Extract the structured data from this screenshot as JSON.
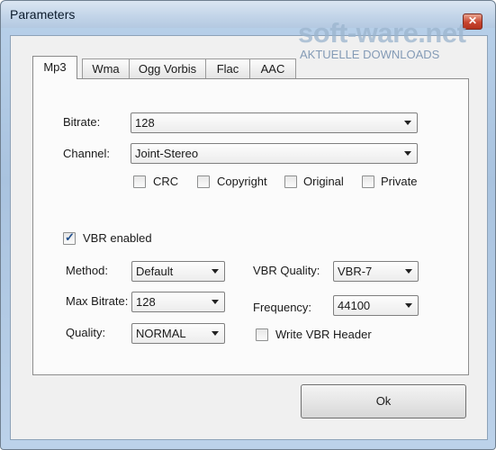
{
  "window": {
    "title": "Parameters",
    "close_glyph": "✕"
  },
  "watermark": {
    "main": "soft-ware.net",
    "sub": "AKTUELLE DOWNLOADS"
  },
  "tabs": [
    "Mp3",
    "Wma",
    "Ogg Vorbis",
    "Flac",
    "AAC"
  ],
  "active_tab": "Mp3",
  "mp3": {
    "bitrate": {
      "label": "Bitrate:",
      "value": "128"
    },
    "channel": {
      "label": "Channel:",
      "value": "Joint-Stereo"
    },
    "flags": [
      {
        "label": "CRC",
        "checked": false
      },
      {
        "label": "Copyright",
        "checked": false
      },
      {
        "label": "Original",
        "checked": false
      },
      {
        "label": "Private",
        "checked": false
      }
    ],
    "vbr_enabled": {
      "label": "VBR enabled",
      "checked": true
    },
    "method": {
      "label": "Method:",
      "value": "Default"
    },
    "max_bitrate": {
      "label": "Max Bitrate:",
      "value": "128"
    },
    "quality": {
      "label": "Quality:",
      "value": "NORMAL"
    },
    "vbr_quality": {
      "label": "VBR Quality:",
      "value": "VBR-7"
    },
    "frequency": {
      "label": "Frequency:",
      "value": "44100"
    },
    "write_vbr_header": {
      "label": "Write VBR Header",
      "checked": false
    }
  },
  "buttons": {
    "ok": "Ok"
  },
  "colors": {
    "titlebar": "#c3d5e9",
    "close": "#c8452f",
    "check_mark": "#1f4e8c"
  },
  "icons": {
    "checkmark": "check-icon",
    "combo_arrow": "chevron-down-icon",
    "close": "close-icon"
  }
}
